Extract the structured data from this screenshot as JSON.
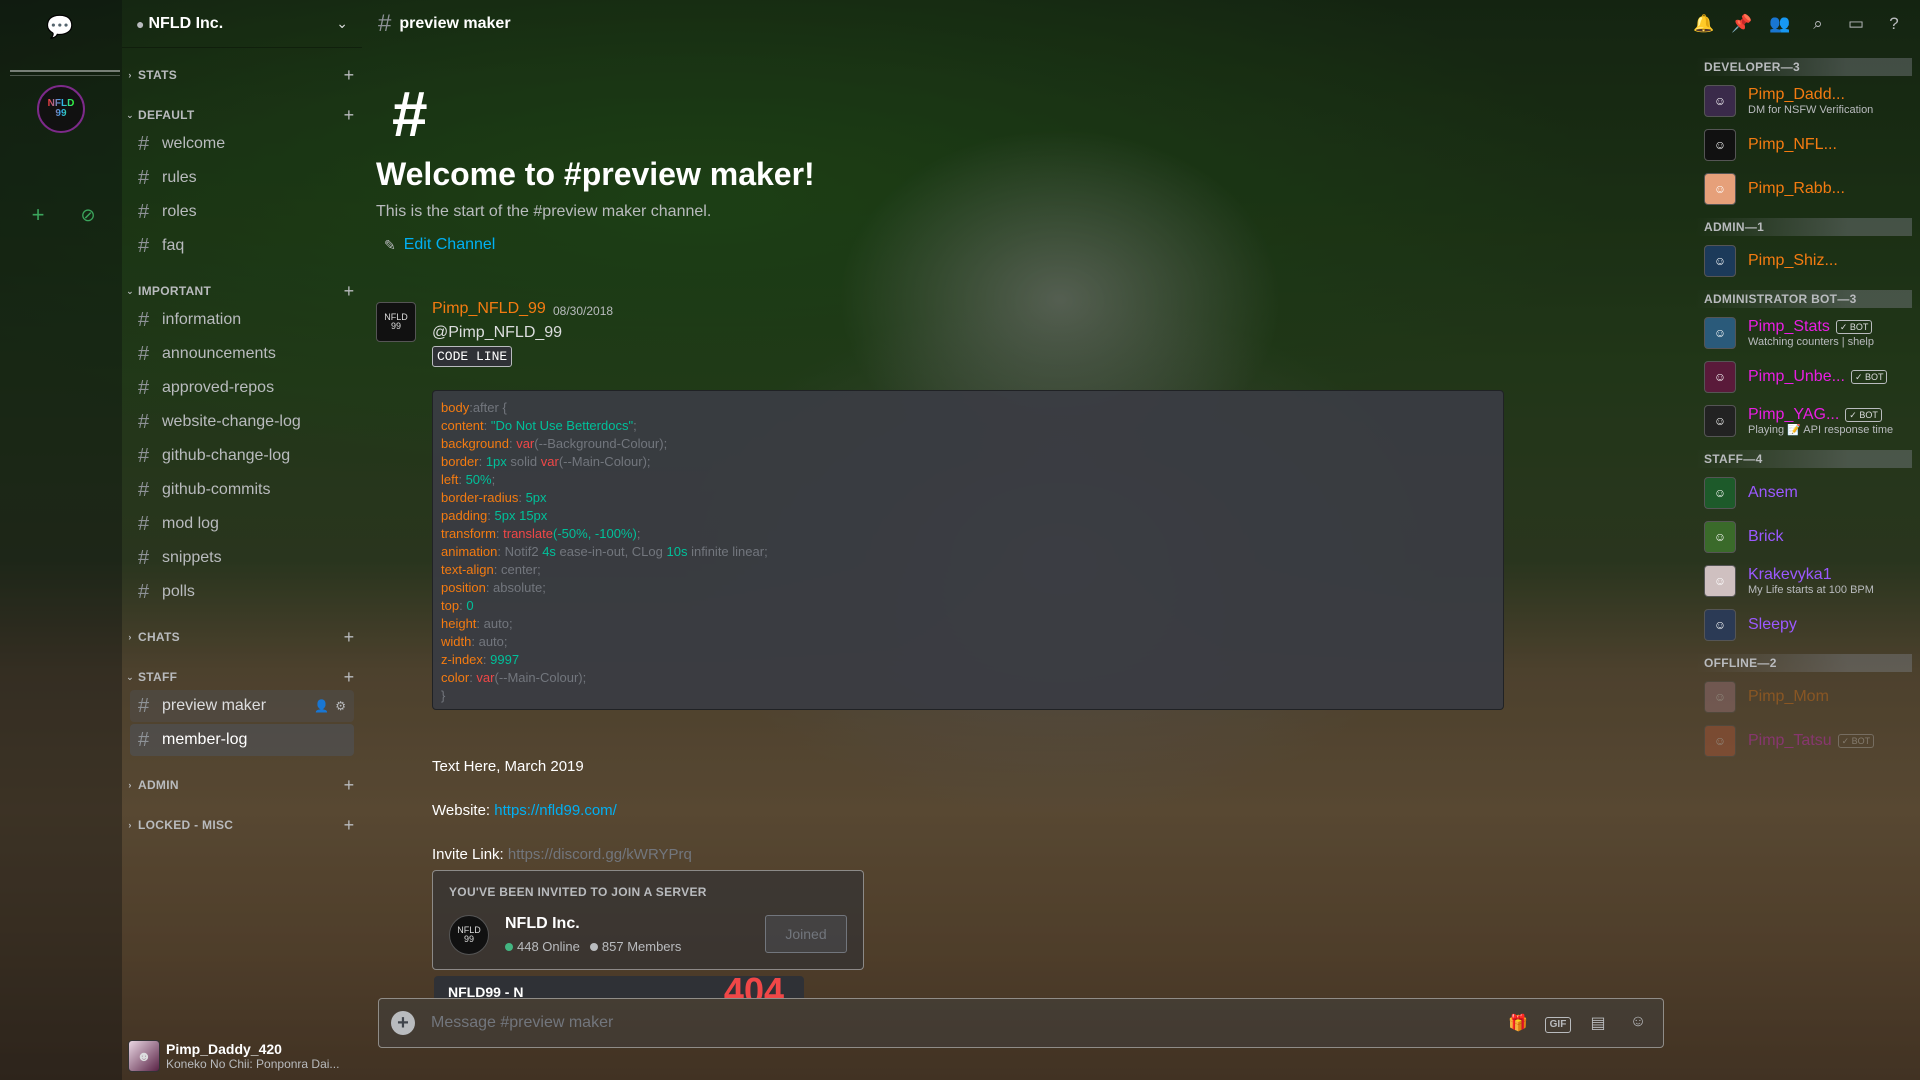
{
  "server": {
    "name": "NFLD Inc."
  },
  "topbar": {
    "channel": "preview maker"
  },
  "sidebar": {
    "categories": [
      {
        "label": "STATS"
      },
      {
        "label": "DEFAULT"
      },
      {
        "label": "IMPORTANT"
      },
      {
        "label": "CHATS"
      },
      {
        "label": "STAFF"
      },
      {
        "label": "ADMIN"
      },
      {
        "label": "LOCKED - MISC"
      }
    ],
    "channels": [
      {
        "label": "welcome"
      },
      {
        "label": "rules"
      },
      {
        "label": "roles"
      },
      {
        "label": "faq"
      },
      {
        "label": "information"
      },
      {
        "label": "announcements"
      },
      {
        "label": "approved-repos"
      },
      {
        "label": "website-change-log"
      },
      {
        "label": "github-change-log"
      },
      {
        "label": "github-commits"
      },
      {
        "label": "mod log"
      },
      {
        "label": "snippets"
      },
      {
        "label": "polls"
      },
      {
        "label": "preview maker"
      },
      {
        "label": "member-log"
      }
    ]
  },
  "user": {
    "name": "Pimp_Daddy_420",
    "status": "Koneko No Chii: Ponponra Dai..."
  },
  "chat": {
    "welcome_title": "Welcome to #preview maker!",
    "welcome_sub": "This is the start of the #preview maker channel.",
    "edit_channel": "Edit Channel",
    "message": {
      "author": "Pimp_NFLD_99",
      "timestamp": "08/30/2018",
      "mention": "@Pimp_NFLD_99",
      "code_label": "CODE LINE",
      "code": [
        {
          "k": "body",
          "rest": ":after {"
        },
        {
          "k": "content",
          "s": "\"Do Not Use Betterdocs\"",
          "end": ";"
        },
        {
          "k": "background",
          "f": "var",
          "d": "(--Background-Colour);"
        },
        {
          "k": "border",
          "n": "1px",
          "d": "solid",
          "f": "var",
          "d2": "(--Main-Colour);"
        },
        {
          "k": "left",
          "n": "50%",
          "end": ";"
        },
        {
          "k": "border-radius",
          "n": "5px",
          "end": ""
        },
        {
          "k": "padding",
          "n": "5px 15px",
          "end": ""
        },
        {
          "k": "transform",
          "f": "translate",
          "n": "(-50%, -100%)",
          "end": ";"
        },
        {
          "k": "animation",
          "d": "Notif2",
          "n": "4s",
          "d2": "ease-in-out, CLog",
          "n2": "10s",
          "d3": "infinite linear;"
        },
        {
          "k": "text-align",
          "d": "center;"
        },
        {
          "k": "position",
          "d": "absolute;"
        },
        {
          "k": "top",
          "n": "0",
          "end": ""
        },
        {
          "k": "height",
          "d": "auto;"
        },
        {
          "k": "width",
          "d": "auto;"
        },
        {
          "k": "z-index",
          "n": "9997",
          "end": ""
        },
        {
          "k": "color",
          "f": "var",
          "d": "(--Main-Colour);"
        },
        {
          "close": "}"
        }
      ],
      "text_line": "Text Here, March 2019",
      "website_label": "Website:",
      "website_url": "https://nfld99.com/",
      "invite_label": "Invite Link:",
      "invite_url": "https://discord.gg/kWRYPrq"
    },
    "invite_card": {
      "header": "YOU'VE BEEN INVITED TO JOIN A SERVER",
      "server": "NFLD Inc.",
      "online": "448 Online",
      "members": "857 Members",
      "button": "Joined"
    },
    "composer_placeholder": "Message #preview maker"
  },
  "members": {
    "groups": [
      {
        "title": "DEVELOPER—3",
        "items": [
          {
            "name": "Pimp_Dadd...",
            "activity": "DM for NSFW Verification",
            "color": "#f47b11"
          },
          {
            "name": "Pimp_NFL...",
            "activity": "",
            "color": "#f47b11"
          },
          {
            "name": "Pimp_Rabb...",
            "activity": "",
            "color": "#f47b11"
          }
        ]
      },
      {
        "title": "ADMIN—1",
        "items": [
          {
            "name": "Pimp_Shiz...",
            "activity": "",
            "color": "#f47b11"
          }
        ]
      },
      {
        "title": "ADMINISTRATOR BOT—3",
        "items": [
          {
            "name": "Pimp_Stats",
            "activity": "Watching counters | shelp",
            "color": "#e91ee3",
            "bot": "BOT"
          },
          {
            "name": "Pimp_Unbe...",
            "activity": "",
            "color": "#e91ee3",
            "bot": "BOT"
          },
          {
            "name": "Pimp_YAG...",
            "activity": "Playing 📝 API response time",
            "color": "#e91ee3",
            "bot": "BOT"
          }
        ]
      },
      {
        "title": "STAFF—4",
        "items": [
          {
            "name": "Ansem",
            "activity": "",
            "color": "#9b59ff"
          },
          {
            "name": "Brick",
            "activity": "",
            "color": "#9b59ff"
          },
          {
            "name": "Krakevyka1",
            "activity": "My Life starts at 100 BPM",
            "color": "#9b59ff"
          },
          {
            "name": "Sleepy",
            "activity": "",
            "color": "#9b59ff"
          }
        ]
      },
      {
        "title": "OFFLINE—2",
        "items": [
          {
            "name": "Pimp_Mom",
            "activity": "",
            "color": "#f47b11"
          },
          {
            "name": "Pimp_Tatsu",
            "activity": "",
            "color": "#e91ee3",
            "bot": "BOT"
          }
        ]
      }
    ]
  },
  "colors": {
    "accent": "#f47b11",
    "link": "#00b0f4",
    "online": "#43b581",
    "bot_role": "#e91ee3",
    "staff_role": "#9b59ff"
  }
}
